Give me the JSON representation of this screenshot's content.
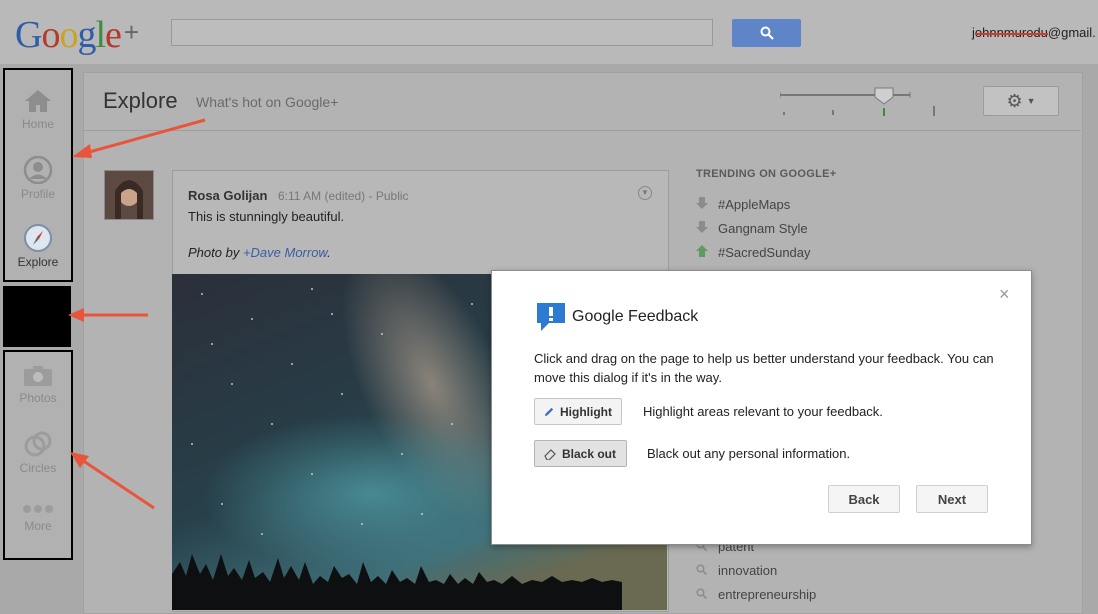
{
  "topbar": {
    "logo_text": "Google",
    "logo_plus": "+",
    "account_email": "johnnmurodu@gmail."
  },
  "explore": {
    "title": "Explore",
    "subtitle": "What's hot on Google+"
  },
  "nav": {
    "items": [
      {
        "label": "Home",
        "icon": "home-icon"
      },
      {
        "label": "Profile",
        "icon": "profile-icon"
      },
      {
        "label": "Explore",
        "icon": "compass-icon"
      },
      {
        "label": "Photos",
        "icon": "camera-icon"
      },
      {
        "label": "Circles",
        "icon": "circles-icon"
      },
      {
        "label": "More",
        "icon": "more-dots-icon"
      }
    ]
  },
  "post": {
    "author": "Rosa Golijan",
    "time": "6:11 AM (edited)",
    "visibility": "Public",
    "text": "This is stunningly beautiful.",
    "credit_prefix": "Photo by ",
    "credit_link": "+Dave Morrow",
    "credit_suffix": "."
  },
  "trending": {
    "title": "TRENDING ON GOOGLE+",
    "items": [
      {
        "label": "#AppleMaps",
        "direction": "down"
      },
      {
        "label": "Gangnam Style",
        "direction": "down"
      },
      {
        "label": "#SacredSunday",
        "direction": "up"
      }
    ],
    "related": [
      "patent",
      "innovation",
      "entrepreneurship"
    ]
  },
  "feedback_dialog": {
    "title": "Google Feedback",
    "description": "Click and drag on the page to help us better understand your feedback. You can move this dialog if it's in the way.",
    "highlight_label": "Highlight",
    "highlight_desc": "Highlight areas relevant to your feedback.",
    "blackout_label": "Black out",
    "blackout_desc": "Black out any personal information.",
    "back_label": "Back",
    "next_label": "Next",
    "close_glyph": "×"
  },
  "colors": {
    "annotation_arrow": "#e8553b",
    "search_button": "#5f85c9",
    "link": "#3a5fa2"
  }
}
